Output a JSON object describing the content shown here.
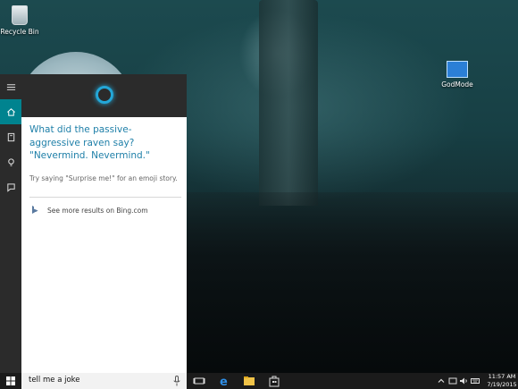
{
  "desktop": {
    "icons": [
      {
        "label": "Recycle Bin"
      },
      {
        "label": "GodMode"
      }
    ]
  },
  "cortana": {
    "rail": [
      "menu-icon",
      "home-icon",
      "notebook-icon",
      "lightbulb-icon",
      "feedback-icon"
    ],
    "answer": "What did the passive-aggressive raven say? \"Nevermind. Nevermind.\"",
    "hint": "Try saying \"Surprise me!\" for an emoji story.",
    "bing_link": "See more results on Bing.com",
    "accent": "#1e7fa8"
  },
  "taskbar": {
    "search_value": "tell me a joke",
    "apps": [
      "task-view-icon",
      "edge-icon",
      "file-explorer-icon",
      "store-icon"
    ],
    "clock_time": "11:57 AM",
    "clock_date": "7/19/2015"
  }
}
